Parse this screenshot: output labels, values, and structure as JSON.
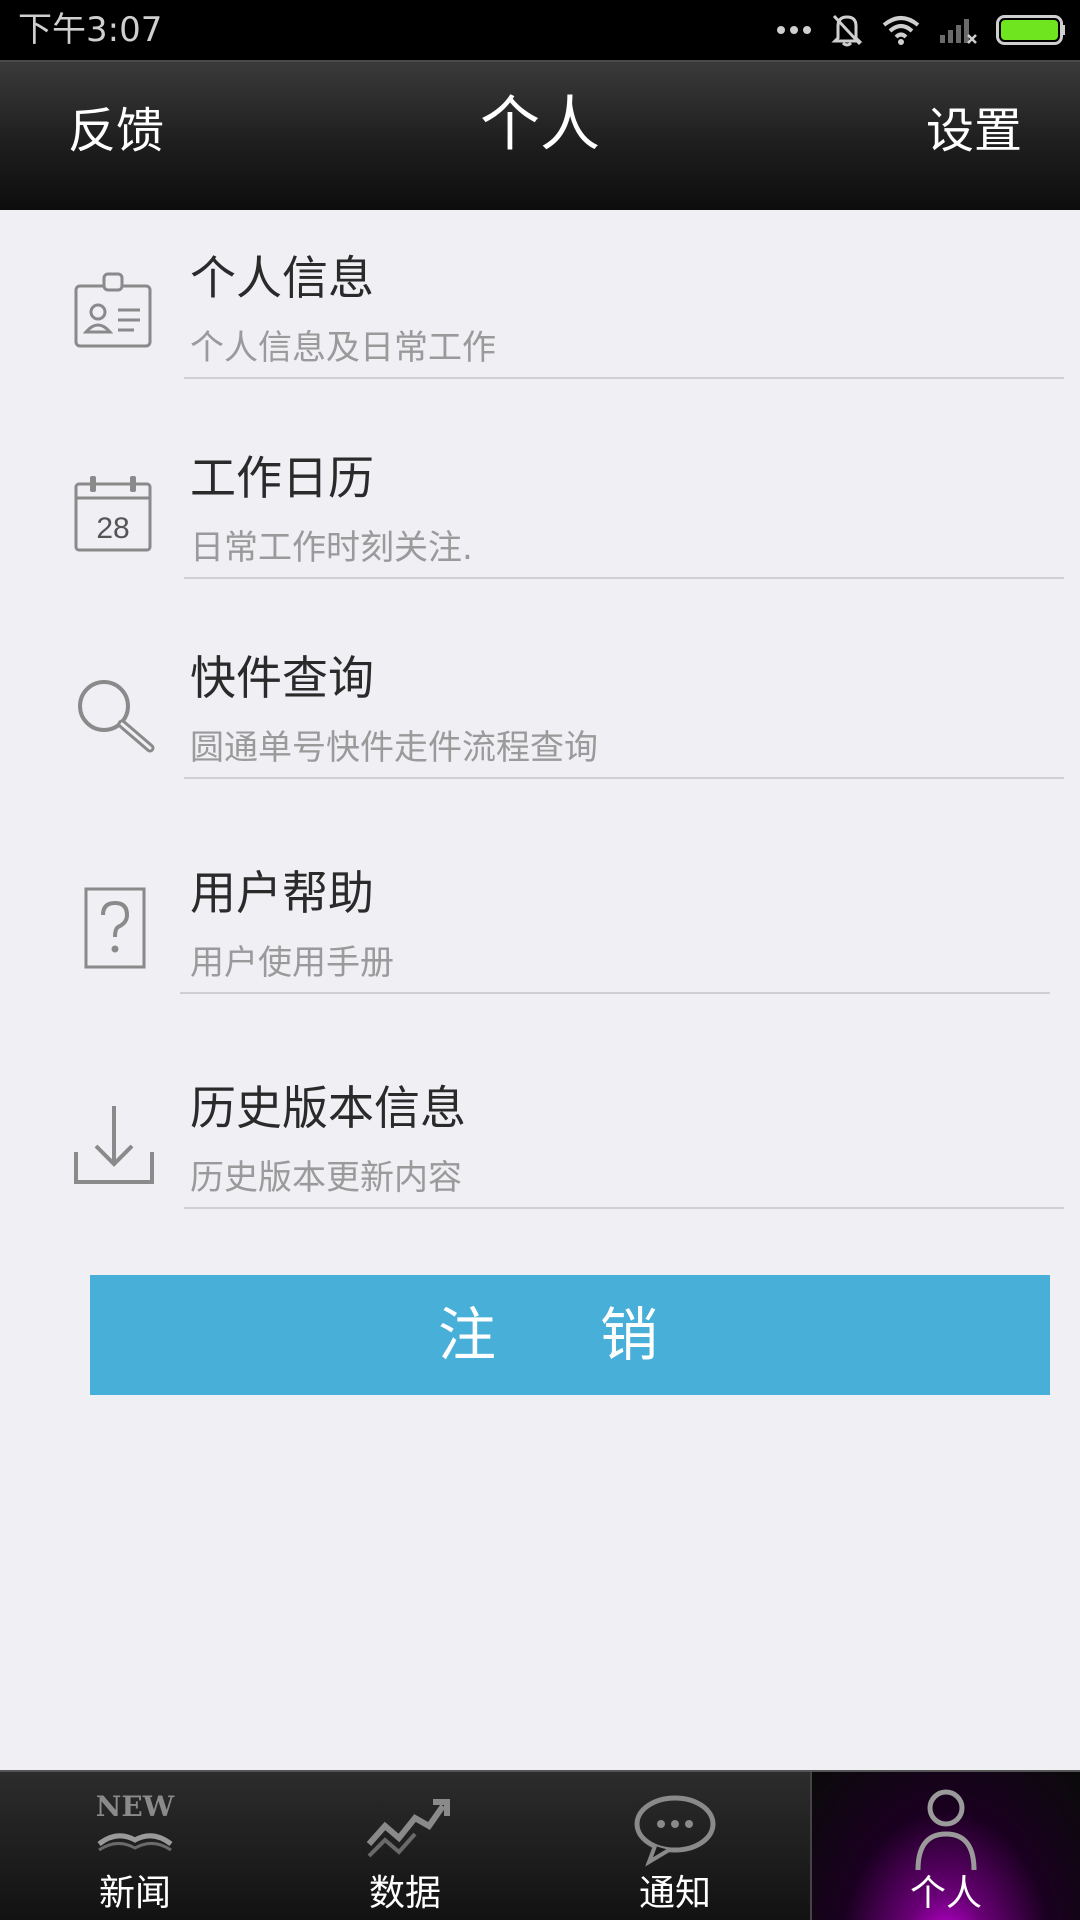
{
  "status_bar": {
    "time": "下午3:07",
    "icons": [
      "more-dots-icon",
      "mute-icon",
      "wifi-icon",
      "signal-icon",
      "battery-icon"
    ]
  },
  "title_bar": {
    "left_label": "反馈",
    "title": "个人",
    "right_label": "设置"
  },
  "menu": [
    {
      "icon": "id-card-icon",
      "title": "个人信息",
      "subtitle": "个人信息及日常工作"
    },
    {
      "icon": "calendar-icon",
      "title": "工作日历",
      "subtitle": "日常工作时刻关注.",
      "calendar_day": "28"
    },
    {
      "icon": "search-icon",
      "title": "快件查询",
      "subtitle": "圆通单号快件走件流程查询"
    },
    {
      "icon": "help-icon",
      "title": "用户帮助",
      "subtitle": "用户使用手册"
    },
    {
      "icon": "download-icon",
      "title": "历史版本信息",
      "subtitle": "历史版本更新内容"
    }
  ],
  "logout": {
    "label": "注 销",
    "color": "#48afd8"
  },
  "tabs": [
    {
      "icon": "news-icon",
      "label": "新闻",
      "icon_text": "NEW",
      "active": false
    },
    {
      "icon": "chart-icon",
      "label": "数据",
      "active": false
    },
    {
      "icon": "chat-icon",
      "label": "通知",
      "active": false
    },
    {
      "icon": "person-icon",
      "label": "个人",
      "active": true
    }
  ],
  "colors": {
    "accent": "#48afd8",
    "battery": "#6ee51f",
    "active_tab_glow": "#d100e6"
  }
}
